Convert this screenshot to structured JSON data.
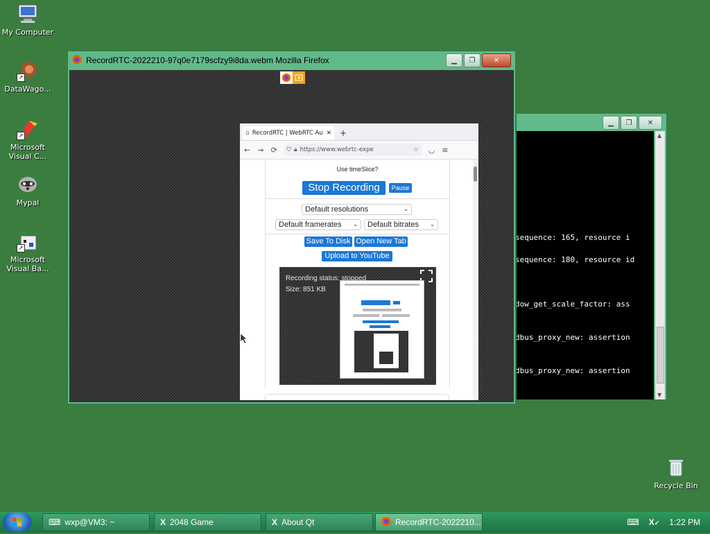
{
  "desktop": {
    "icons": [
      {
        "label": "My Computer",
        "icon": "computer-icon"
      },
      {
        "label": "DataWago...",
        "icon": "datawagon-icon"
      },
      {
        "label": "Microsoft Visual C...",
        "icon": "visual-c-icon"
      },
      {
        "label": "Mypal",
        "icon": "mypal-icon"
      },
      {
        "label": "Microsoft Visual Ba...",
        "icon": "visual-basic-icon"
      },
      {
        "label": "Recycle Bin",
        "icon": "recycle-bin-icon"
      }
    ]
  },
  "firefox_window": {
    "title": "RecordRTC-2022210-97q0e7179scfzy9i8da.webm  Mozilla Firefox",
    "inner_browser": {
      "tab_title": "RecordRTC | WebRTC Au",
      "url": "https://www.webrtc-expe",
      "use_timeslice": "Use timeSlice?",
      "stop_recording": "Stop Recording",
      "pause": "Pause",
      "resolutions": "Default resolutions",
      "framerates": "Default framerates",
      "bitrates": "Default bitrates",
      "save_to_disk": "Save To Disk",
      "open_new_tab": "Open New Tab",
      "upload_youtube": "Upload to YouTube",
      "recording_status": "Recording status: stopped",
      "size": "Size: 851 KB"
    }
  },
  "terminal": {
    "lines": [
      "sequence: 165, resource i",
      "sequence: 180, resource id",
      "dow_get_scale_factor: ass",
      "dbus_proxy_new: assertion",
      "dbus_proxy_new: assertion"
    ]
  },
  "taskbar": {
    "tasks": [
      "wxp@VM3: ~",
      "2048 Game",
      "About Qt",
      "RecordRTC-2022210..."
    ],
    "clock": "1:22 PM"
  },
  "colors": {
    "desktop": "#3a7d3f",
    "window_frame": "#62b98a",
    "accent_blue": "#1b78d4"
  }
}
